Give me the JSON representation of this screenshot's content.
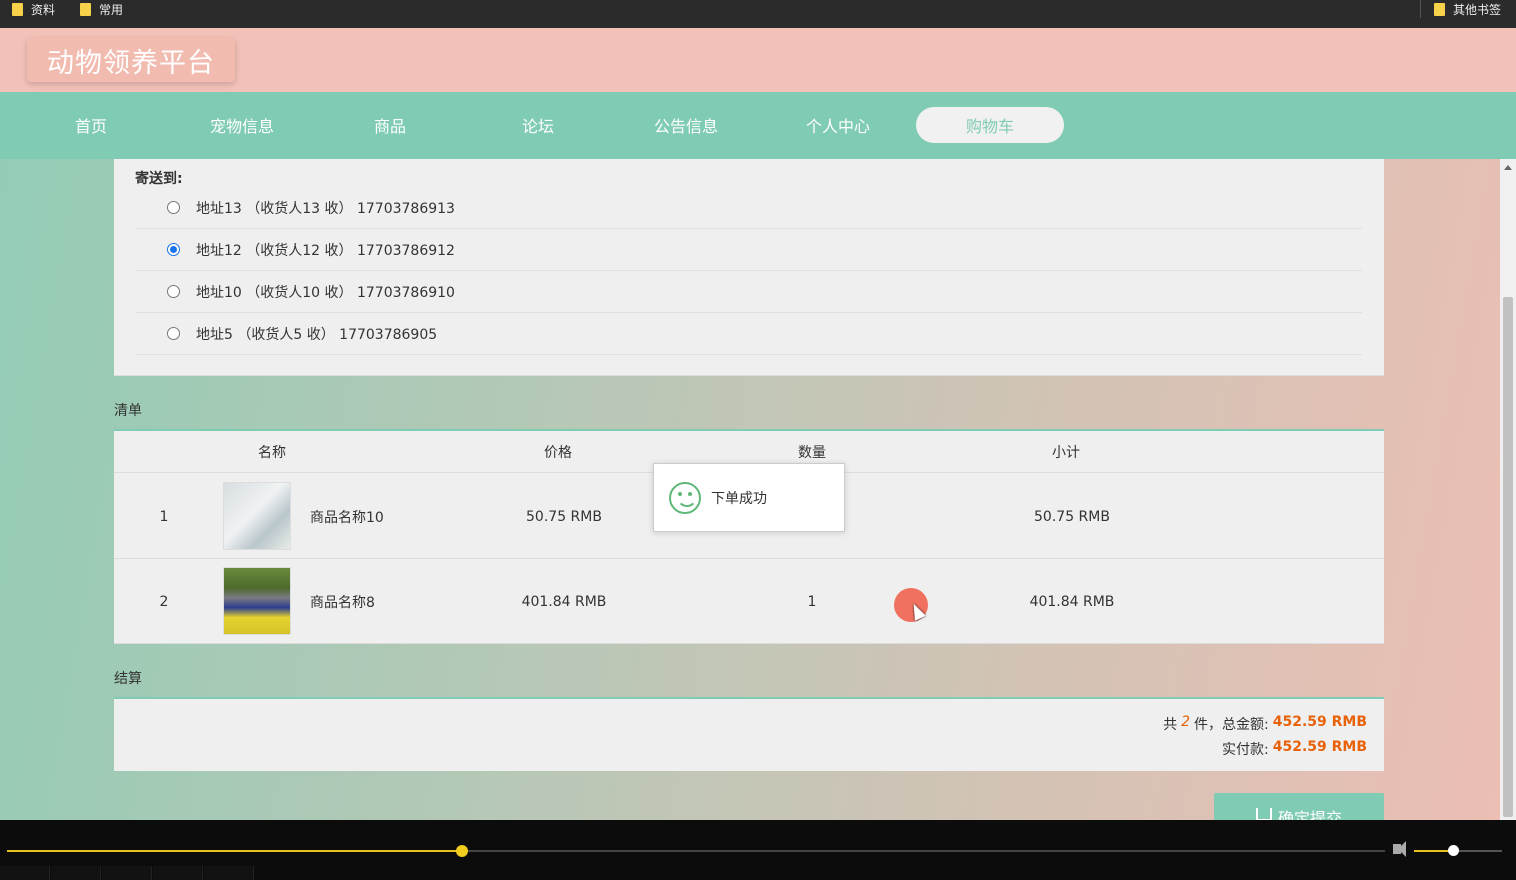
{
  "bookmarks": {
    "left": [
      {
        "label": "资料",
        "icon": "folder-icon"
      },
      {
        "label": "常用",
        "icon": "folder-icon"
      }
    ],
    "right": {
      "label": "其他书签",
      "icon": "folder-icon"
    }
  },
  "site": {
    "logo": "动物领养平台"
  },
  "nav": {
    "items": [
      {
        "label": "首页"
      },
      {
        "label": "宠物信息"
      },
      {
        "label": "商品"
      },
      {
        "label": "论坛"
      },
      {
        "label": "公告信息"
      },
      {
        "label": "个人中心"
      },
      {
        "label": "购物车",
        "active": true
      }
    ]
  },
  "address": {
    "title": "寄送到:",
    "options": [
      {
        "text": "地址13 （收货人13 收） 17703786913",
        "selected": false
      },
      {
        "text": "地址12 （收货人12 收） 17703786912",
        "selected": true
      },
      {
        "text": "地址10 （收货人10 收） 17703786910",
        "selected": false
      },
      {
        "text": "地址5 （收货人5 收） 17703786905",
        "selected": false
      }
    ]
  },
  "list": {
    "section_label": "清单",
    "headers": {
      "name": "名称",
      "price": "价格",
      "qty": "数量",
      "subtotal": "小计"
    },
    "rows": [
      {
        "index": "1",
        "name": "商品名称10",
        "price": "50.75 RMB",
        "qty": "",
        "subtotal": "50.75 RMB"
      },
      {
        "index": "2",
        "name": "商品名称8",
        "price": "401.84 RMB",
        "qty": "1",
        "subtotal": "401.84 RMB"
      }
    ]
  },
  "settle": {
    "section_label": "结算",
    "count_prefix": "共",
    "count": "2",
    "count_suffix": "件，总金额:",
    "total": "452.59 RMB",
    "paid_label": "实付款:",
    "paid": "452.59 RMB"
  },
  "submit": {
    "label": "确定提交",
    "icon": "cart-icon"
  },
  "toast": {
    "text": "下单成功",
    "icon": "smile-icon"
  },
  "player": {
    "progress": 0.33,
    "volume": 0.44
  },
  "colors": {
    "accent": "#80cbb4",
    "header": "#f2c1b8",
    "price": "#e8620a"
  }
}
